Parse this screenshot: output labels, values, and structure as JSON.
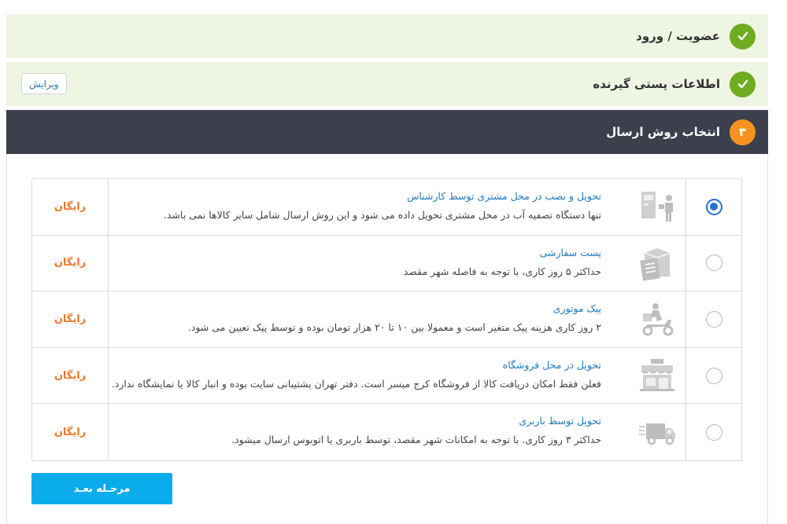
{
  "steps": [
    {
      "title": "عضویت / ورود",
      "status": "done",
      "icon": "check-icon"
    },
    {
      "title": "اطلاعات پستی گیرنده",
      "status": "done",
      "icon": "check-icon",
      "edit_label": "ویرایش"
    },
    {
      "title": "انتخاب روش ارسال",
      "status": "active",
      "number": "۳"
    }
  ],
  "shipping_options": [
    {
      "title": "تحویل و نصب در محل مشتری توسط کارشناس",
      "description": "تنها دستگاه تصفیه آب در محل مشتری تحویل داده می شود و این روش ارسال شامل سایر کالاها نمی باشد.",
      "price": "رایگان",
      "selected": true,
      "icon": "technician-delivery-icon"
    },
    {
      "title": "پست سفارشی",
      "description": "حداکثر ۵ روز کاری، با توجه به فاصله شهر مقصد",
      "price": "رایگان",
      "selected": false,
      "icon": "post-package-icon"
    },
    {
      "title": "پیک موتوری",
      "description": "۲ روز کاری هزینه پیک متغیر است و معمولا بین ۱۰ تا ۲۰ هزار تومان بوده و توسط پیک تعیین می شود.",
      "price": "رایگان",
      "selected": false,
      "icon": "motorcycle-courier-icon"
    },
    {
      "title": "تحویل در محل فروشگاه",
      "description": "فعلن فقط امکان دریافت کالا از فروشگاه کرج میسر است. دفتر تهران پشتیبانی سایت بوده و انبار کالا یا نمایشگاه ندارد.",
      "price": "رایگان",
      "selected": false,
      "icon": "shop-icon"
    },
    {
      "title": "تحویل توسط باربری",
      "description": "حداکثر ۳ روز کاری. با توجه به امکانات شهر مقصد، توسط باربری یا اتوبوس ارسال میشود.",
      "price": "رایگان",
      "selected": false,
      "icon": "delivery-truck-icon"
    }
  ],
  "next_button": "مرحـله بعـد",
  "colors": {
    "accent": "#0aaceb",
    "done": "#6fac1e",
    "active_step": "#f7931e",
    "price": "#f0782a",
    "link": "#1f7cc2",
    "dark_bar": "#3c3f4c"
  }
}
